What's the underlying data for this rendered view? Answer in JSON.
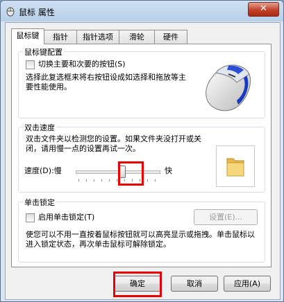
{
  "window": {
    "title": "鼠标 属性",
    "close_label": "✕"
  },
  "tabs": [
    "鼠标键",
    "指针",
    "指针选项",
    "滑轮",
    "硬件"
  ],
  "button_config": {
    "title": "鼠标键配置",
    "switch_label": "切换主要和次要的按钮(S)",
    "description": "选择此复选框来将右按钮设成如选择和拖放等主要性能使用。"
  },
  "double_click": {
    "title": "双击速度",
    "description": "双击文件夹以检测您的设置。如果文件夹没打开或关闭，请用慢一点的设置再试一次。",
    "speed_label": "速度(D):慢",
    "fast_label": "快",
    "speed_level": 0.55
  },
  "click_lock": {
    "title": "单击锁定",
    "enable_label": "启用单击锁定(T)",
    "settings_button": "设置(E)...",
    "description": "使您可以不用一直按着鼠标按钮就可以高亮显示或拖拽。单击鼠标以进入锁定状态，再次单击鼠标可解除锁定。"
  },
  "footer": {
    "ok": "确定",
    "cancel": "取消",
    "apply": "应用(A)"
  },
  "colors": {
    "highlight": "#e60000",
    "folder": "#f2c866"
  }
}
